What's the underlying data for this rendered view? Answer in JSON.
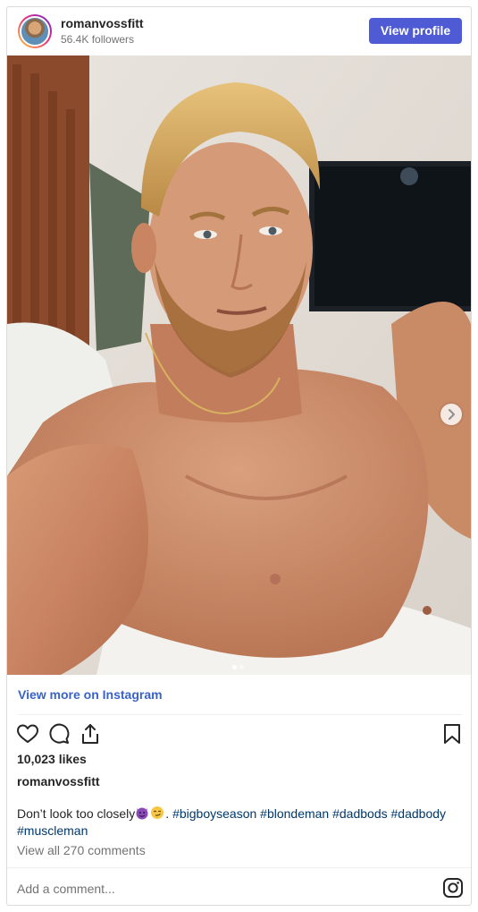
{
  "header": {
    "username": "romanvossfitt",
    "followers": "56.4K followers",
    "view_profile_label": "View profile"
  },
  "carousel": {
    "current_slide": 1,
    "total_slides": 2,
    "next_icon": "chevron-right-icon"
  },
  "footer": {
    "view_more_label": "View more on Instagram",
    "likes": "10,023 likes",
    "caption_username": "romanvossfitt",
    "caption_text": "Don’t look too closely",
    "caption_emojis": [
      "smiling-imp-emoji",
      "smirk-emoji"
    ],
    "caption_after_emoji": ".",
    "hashtags": [
      "#bigboyseason",
      "#blondeman",
      "#dadbods",
      "#dadbody",
      "#muscleman"
    ],
    "view_comments": "View all 270 comments",
    "add_comment_placeholder": "Add a comment...",
    "icons": [
      "heart-icon",
      "comment-icon",
      "share-icon",
      "bookmark-icon",
      "instagram-icon"
    ]
  },
  "colors": {
    "button": "#4f5bd5",
    "link": "#3a63c7",
    "hashtag": "#00376b",
    "muted": "#737373"
  }
}
